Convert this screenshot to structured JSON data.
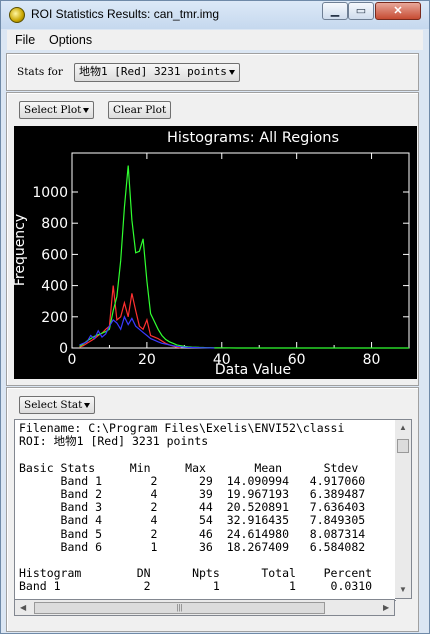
{
  "window": {
    "title": "ROI Statistics Results: can_tmr.img"
  },
  "menu": {
    "file": "File",
    "options": "Options"
  },
  "stats_for": {
    "label": "Stats for",
    "selected": "地物1 [Red] 3231 points"
  },
  "plot_toolbar": {
    "select_plot": "Select Plot",
    "clear_plot": "Clear Plot"
  },
  "chart_data": {
    "type": "line",
    "title": "Histograms: All Regions",
    "xlabel": "Data Value",
    "ylabel": "Frequency",
    "xlim": [
      0,
      90
    ],
    "ylim": [
      0,
      1250
    ],
    "xticks": [
      0,
      20,
      40,
      60,
      80
    ],
    "yticks": [
      0,
      200,
      400,
      600,
      800,
      1000
    ],
    "background": "#000000",
    "series": [
      {
        "color": "#ff3030",
        "x": [
          2,
          3,
          4,
          5,
          6,
          7,
          8,
          9,
          10,
          11,
          12,
          13,
          14,
          15,
          16,
          17,
          18,
          19,
          20,
          21,
          22,
          23,
          24,
          25,
          26,
          27,
          28,
          29
        ],
        "values": [
          5,
          15,
          30,
          45,
          60,
          80,
          95,
          120,
          140,
          400,
          180,
          200,
          290,
          200,
          350,
          240,
          140,
          120,
          180,
          80,
          70,
          60,
          45,
          30,
          20,
          12,
          6,
          2
        ]
      },
      {
        "color": "#30ff30",
        "x": [
          2,
          3,
          4,
          5,
          6,
          7,
          8,
          9,
          10,
          11,
          12,
          13,
          14,
          15,
          16,
          17,
          18,
          19,
          20,
          21,
          22,
          23,
          24,
          25,
          26,
          27,
          28,
          29,
          30,
          31,
          32,
          33,
          34,
          35,
          36,
          37,
          38,
          39,
          40,
          44,
          50,
          60,
          70,
          80,
          90
        ],
        "values": [
          10,
          25,
          45,
          60,
          75,
          85,
          95,
          105,
          120,
          240,
          330,
          560,
          900,
          1170,
          820,
          610,
          620,
          700,
          430,
          220,
          170,
          120,
          80,
          55,
          40,
          30,
          20,
          15,
          10,
          8,
          6,
          5,
          4,
          3,
          2,
          2,
          1,
          1,
          1,
          0,
          0,
          0,
          0,
          0,
          0
        ]
      },
      {
        "color": "#3a3aff",
        "x": [
          2,
          4,
          5,
          6,
          7,
          8,
          9,
          10,
          11,
          12,
          13,
          14,
          15,
          16,
          17,
          18,
          19,
          20,
          21,
          22,
          23,
          24,
          25,
          26,
          27,
          28,
          29,
          30,
          31,
          32,
          34,
          36,
          38
        ],
        "values": [
          20,
          40,
          80,
          60,
          110,
          70,
          90,
          140,
          180,
          160,
          120,
          200,
          150,
          190,
          140,
          120,
          100,
          80,
          60,
          50,
          40,
          30,
          25,
          20,
          15,
          10,
          8,
          6,
          4,
          3,
          2,
          1,
          0
        ]
      }
    ]
  },
  "stats_panel": {
    "select_stat": "Select Stat",
    "text_lines": [
      "Filename: C:\\Program Files\\Exelis\\ENVI52\\classi",
      "ROI: 地物1 [Red] 3231 points",
      "",
      "Basic Stats     Min     Max       Mean      Stdev",
      "      Band 1       2      29  14.090994   4.917060",
      "      Band 2       4      39  19.967193   6.389487",
      "      Band 3       2      44  20.520891   7.636403",
      "      Band 4       4      54  32.916435   7.849305",
      "      Band 5       2      46  24.614980   8.087314",
      "      Band 6       1      36  18.267409   6.584082",
      "",
      "Histogram        DN      Npts      Total    Percent",
      "Band 1            2         1          1     0.0310"
    ]
  }
}
